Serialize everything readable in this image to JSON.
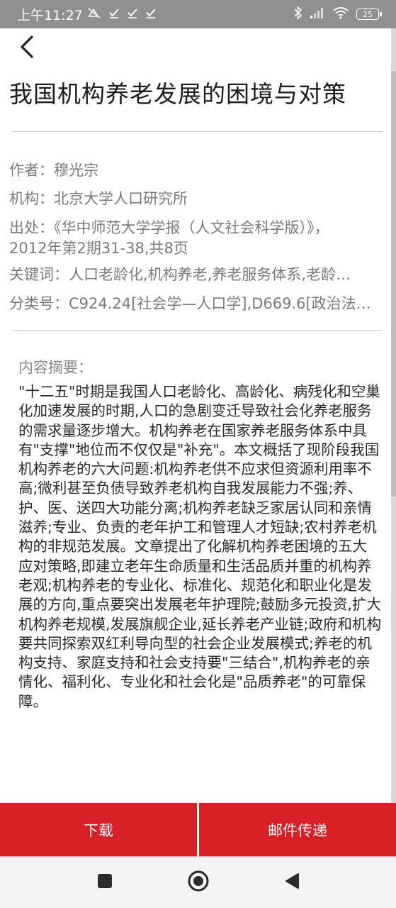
{
  "status_bar": {
    "time": "上午11:27",
    "battery_level": "25"
  },
  "article": {
    "title": "我国机构养老发展的困境与对策",
    "author": "作者：穆光宗",
    "institution": "机构：北京大学人口研究所",
    "source": "出处：《华中师范大学学报（人文社会科学版）》，2012年第2期31-38,共8页",
    "keywords": "关键词：人口老龄化,机构养老,养老服务体系,老龄…",
    "classification": "分类号：C924.24[社会学—人口学],D669.6[政治法…",
    "abstract_label": "内容摘要：",
    "abstract": "\"十二五\"时期是我国人口老龄化、高龄化、病残化和空巢化加速发展的时期,人口的急剧变迁导致社会化养老服务的需求量逐步增大。机构养老在国家养老服务体系中具有\"支撑\"地位而不仅仅是\"补充\"。本文概括了现阶段我国机构养老的六大问题:机构养老供不应求但资源利用率不高;微利甚至负债导致养老机构自我发展能力不强;养、护、医、送四大功能分离;机构养老缺乏家居认同和亲情滋养;专业、负责的老年护工和管理人才短缺;农村养老机构的非规范发展。文章提出了化解机构养老困境的五大应对策略,即建立老年生命质量和生活品质并重的机构养老观;机构养老的专业化、标准化、规范化和职业化是发展的方向,重点要突出发展老年护理院;鼓励多元投资,扩大机构养老规模,发展旗舰企业,延长养老产业链;政府和机构要共同探索双红利导向型的社会企业发展模式;养老的机构支持、家庭支持和社会支持要\"三结合\",机构养老的亲情化、福利化、专业化和社会化是\"品质养老\"的可靠保障。"
  },
  "actions": {
    "download_label": "下载",
    "email_label": "邮件传递"
  },
  "colors": {
    "accent": "#d81f26",
    "status_bar_bg": "#8f8f8f"
  }
}
